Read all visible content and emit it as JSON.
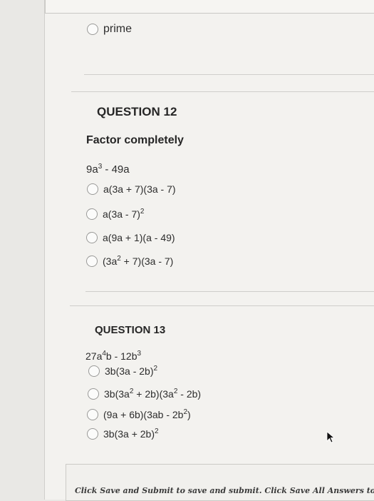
{
  "previous_question": {
    "option": "prime"
  },
  "question12": {
    "title": "QUESTION 12",
    "prompt": "Factor completely",
    "expression": {
      "base": "9a",
      "exp": "3",
      "rest": " - 49a"
    },
    "options": [
      {
        "pre": "a(3a + 7)(3a - 7)"
      },
      {
        "pre": "a(3a - 7)",
        "sup": "2",
        "post": ""
      },
      {
        "pre": "a(9a + 1)(a - 49)"
      },
      {
        "pre": "(3a",
        "sup": "2",
        "post": " + 7)(3a - 7)"
      }
    ]
  },
  "question13": {
    "title": "QUESTION 13",
    "expression": {
      "a": "27a",
      "exp1": "4",
      "b": "b - 12b",
      "exp2": "3"
    },
    "options": [
      {
        "pre": "3b(3a - 2b)",
        "sup": "2",
        "post": ""
      },
      {
        "pre": "3b(3a",
        "sup": "2",
        "mid": " + 2b)(3a",
        "sup2": "2",
        "post": " - 2b)"
      },
      {
        "pre": "(9a + 6b)(3ab - 2b",
        "sup": "2",
        "post": ")"
      },
      {
        "pre": "3b(3a + 2b)",
        "sup": "2",
        "post": ""
      }
    ]
  },
  "footer": {
    "text": "Click Save and Submit to save and submit. Click Save All Answers to s"
  }
}
